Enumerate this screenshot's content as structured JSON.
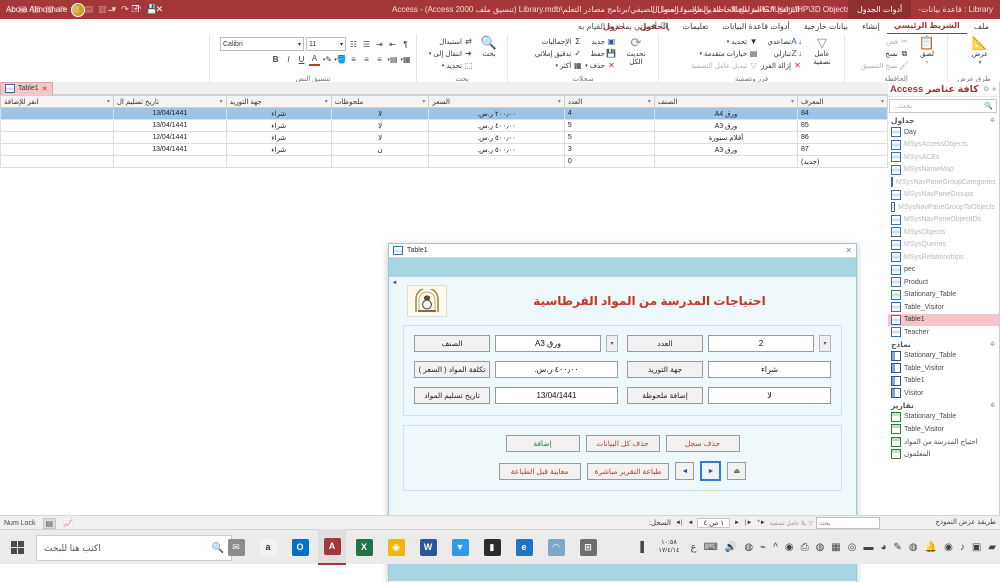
{
  "titlebar": {
    "doc_title": "البرامج الخاصة بالطلاب الذين درسوا الفصل الصيفي/برنامج مصادر التعلم\\Library.mdb (تنسيق ملف Access 2000)  -  Access",
    "doc_path": "C:\\Users\\HP\\3D Objects\\البرامج الخاصة بالطلاب درسوا ال",
    "db_name": "Library : قاعدة بيانات-",
    "context_tab": "أدوات الجدول",
    "account_name": "Abo-a Almoshare",
    "qat": [
      "save-icon",
      "undo-icon",
      "redo-icon",
      "customize-icon"
    ],
    "window_buttons": [
      "minimize",
      "restore",
      "close"
    ]
  },
  "ribbon": {
    "tabs": [
      {
        "label": "ملف",
        "state": "normal"
      },
      {
        "label": "الشريط الرئيسي",
        "state": "active"
      },
      {
        "label": "إنشاء",
        "state": "normal"
      },
      {
        "label": "بيانات خارجية",
        "state": "normal"
      },
      {
        "label": "أدوات قاعدة البيانات",
        "state": "normal"
      },
      {
        "label": "تعليمات",
        "state": "normal"
      },
      {
        "label": "الحقول",
        "state": "context"
      },
      {
        "label": "جدول",
        "state": "context"
      }
    ],
    "tellme": "أخبرني بما تريد القيام به",
    "groups": [
      {
        "name": "طرق عرض",
        "label": "طرق عرض",
        "big": {
          "label": "عرض",
          "icon": "view-icon"
        },
        "items": []
      },
      {
        "name": "الحافظة",
        "label": "الحافظة",
        "big": {
          "label": "لصق",
          "icon": "paste-icon"
        },
        "items": [
          {
            "label": "قص",
            "icon": "cut-icon",
            "dim": true
          },
          {
            "label": "نسخ",
            "icon": "copy-icon",
            "dim": false
          },
          {
            "label": "نسخ التنسيق",
            "icon": "format-painter-icon",
            "dim": true
          }
        ]
      },
      {
        "name": "فرز وتصفية",
        "label": "فرز وتصفية",
        "big": {
          "label": "عامل تصفية",
          "icon": "filter-icon"
        },
        "items": [
          {
            "label": "تصاعدي",
            "icon": "sort-asc-icon",
            "dim": false
          },
          {
            "label": "تنازلي",
            "icon": "sort-desc-icon",
            "dim": false
          },
          {
            "label": "إزالة الفرز",
            "icon": "clear-sort-icon",
            "dim": false
          },
          {
            "label": "تحديد",
            "icon": "selection-icon",
            "dim": false
          },
          {
            "label": "خيارات متقدمة",
            "icon": "advanced-icon",
            "dim": false
          },
          {
            "label": "تبديل عامل التصفية",
            "icon": "toggle-filter-icon",
            "dim": true
          }
        ]
      },
      {
        "name": "سجلات",
        "label": "سجلات",
        "big": {
          "label": "تحديث الكل",
          "icon": "refresh-all-icon"
        },
        "items": [
          {
            "label": "جديد",
            "icon": "new-record-icon",
            "dim": false
          },
          {
            "label": "حفظ",
            "icon": "save-record-icon",
            "dim": false
          },
          {
            "label": "حذف",
            "icon": "delete-record-icon",
            "dim": false
          },
          {
            "label": "الإجماليات",
            "icon": "totals-icon",
            "dim": false
          },
          {
            "label": "تدقيق إملائي",
            "icon": "spelling-icon",
            "dim": false
          },
          {
            "label": "أكثر",
            "icon": "more-icon",
            "dim": false
          }
        ]
      },
      {
        "name": "بحث",
        "label": "بحث",
        "big": {
          "label": "بحث",
          "icon": "search-icon"
        },
        "items": [
          {
            "label": "استبدال",
            "icon": "replace-icon",
            "dim": false
          },
          {
            "label": "انتقال إلى",
            "icon": "goto-icon",
            "dim": false
          },
          {
            "label": "تحديد",
            "icon": "select-icon",
            "dim": false
          }
        ]
      },
      {
        "name": "تنسيق النص",
        "label": "تنسيق النص",
        "font_name": "Calibri",
        "font_size": "11",
        "items": [
          {
            "label": "B",
            "icon": "bold-icon"
          },
          {
            "label": "I",
            "icon": "italic-icon"
          },
          {
            "label": "U",
            "icon": "underline-icon"
          },
          {
            "label": "A",
            "icon": "font-color-icon"
          },
          {
            "label": "✎",
            "icon": "highlight-icon"
          },
          {
            "label": "▨",
            "icon": "fill-color-icon"
          },
          {
            "label": "≡",
            "icon": "align-right-icon"
          },
          {
            "label": "≡",
            "icon": "align-center-icon"
          },
          {
            "label": "≡",
            "icon": "align-left-icon"
          },
          {
            "label": "▦",
            "icon": "gridlines-icon"
          },
          {
            "label": "▤",
            "icon": "alternate-row-icon"
          },
          {
            "label": "⇥",
            "icon": "increase-indent-icon"
          },
          {
            "label": "⇤",
            "icon": "decrease-indent-icon"
          },
          {
            "label": "¶",
            "icon": "rtl-direction-icon"
          }
        ]
      }
    ]
  },
  "navpane": {
    "title": "كافة عناصر Access",
    "collapse_icon": "«",
    "dropdown_icon": "⊙",
    "search_placeholder": "بحث...",
    "search_icon": "search-icon",
    "groups": [
      {
        "title": "جداول",
        "items": [
          {
            "label": "Day",
            "type": "table",
            "selected": false
          },
          {
            "label": "MSysAccessObjects",
            "type": "table",
            "selected": false,
            "system": true
          },
          {
            "label": "MSysACEs",
            "type": "table",
            "selected": false,
            "system": true
          },
          {
            "label": "MSysNameMap",
            "type": "table",
            "selected": false,
            "system": true
          },
          {
            "label": "MSysNavPaneGroupCategories",
            "type": "table",
            "selected": false,
            "system": true
          },
          {
            "label": "MSysNavPaneGroups",
            "type": "table",
            "selected": false,
            "system": true
          },
          {
            "label": "MSysNavPaneGroupToObjects",
            "type": "table",
            "selected": false,
            "system": true
          },
          {
            "label": "MSysNavPaneObjectIDs",
            "type": "table",
            "selected": false,
            "system": true
          },
          {
            "label": "MSysObjects",
            "type": "table",
            "selected": false,
            "system": true
          },
          {
            "label": "MSysQueries",
            "type": "table",
            "selected": false,
            "system": true
          },
          {
            "label": "MSysRelationships",
            "type": "table",
            "selected": false,
            "system": true
          },
          {
            "label": "pec",
            "type": "table",
            "selected": false
          },
          {
            "label": "Product",
            "type": "table",
            "selected": false
          },
          {
            "label": "Stationary_Table",
            "type": "table",
            "selected": false
          },
          {
            "label": "Table_Visitor",
            "type": "table",
            "selected": false
          },
          {
            "label": "Table1",
            "type": "table",
            "selected": true
          },
          {
            "label": "Teacher",
            "type": "table",
            "selected": false
          }
        ]
      },
      {
        "title": "نماذج",
        "items": [
          {
            "label": "Stationary_Table",
            "type": "form",
            "selected": false
          },
          {
            "label": "Table_Visitor",
            "type": "form",
            "selected": false
          },
          {
            "label": "Table1",
            "type": "form",
            "selected": false
          },
          {
            "label": "Visitor",
            "type": "form",
            "selected": false
          }
        ]
      },
      {
        "title": "تقارير",
        "items": [
          {
            "label": "Stationary_Table",
            "type": "report",
            "selected": false
          },
          {
            "label": "Table_Visitor",
            "type": "report",
            "selected": false
          },
          {
            "label": "احتياج المدرسة من المواد",
            "type": "report",
            "selected": false
          },
          {
            "label": "المعلمون",
            "type": "report",
            "selected": false
          }
        ]
      }
    ]
  },
  "datasheet": {
    "tab_label": "Table1",
    "tab_close": "✕",
    "columns": [
      {
        "label": "المعرف"
      },
      {
        "label": "الصنف"
      },
      {
        "label": "العدد"
      },
      {
        "label": "السعر"
      },
      {
        "label": "ملحوظات"
      },
      {
        "label": "جهة التوريد"
      },
      {
        "label": "تاريخ تسليم ال"
      },
      {
        "label": "انقر للإضافة"
      }
    ],
    "rows": [
      {
        "selected": true,
        "id": "84",
        "item": "ورق A4",
        "count": "4",
        "price": "٢٠٠٫٠٠ ر.س.",
        "notes": "لا",
        "supplier": "شراء",
        "date": "13/04/1441",
        "add": ""
      },
      {
        "selected": false,
        "id": "85",
        "item": "ورق A3",
        "count": "5",
        "price": "٤٠٠٫٠٠ ر.س.",
        "notes": "لا",
        "supplier": "شراء",
        "date": "13/04/1441",
        "add": ""
      },
      {
        "selected": false,
        "id": "86",
        "item": "أقلام سبورة",
        "count": "5",
        "price": "٥٠٠٫٠٠ ر.س.",
        "notes": "لا",
        "supplier": "شراء",
        "date": "12/04/1441",
        "add": ""
      },
      {
        "selected": false,
        "id": "87",
        "item": "ورق A3",
        "count": "3",
        "price": "٥٠٠٫٠٠ ر.س.",
        "notes": "ن",
        "supplier": "شراء",
        "date": "13/04/1441",
        "add": ""
      },
      {
        "selected": false,
        "id": "(جديد)",
        "item": "",
        "count": "0",
        "price": "",
        "notes": "",
        "supplier": "",
        "date": "",
        "add": "",
        "is_new": true
      }
    ]
  },
  "modal": {
    "title": "Table1",
    "close_icon": "✕",
    "heading": "احتياجات المدرسة من المواد القرطاسية",
    "logo_alt": "school-emblem",
    "fields": [
      {
        "label": "الصنف",
        "value": "ورق A3",
        "has_dropdown": true,
        "ltr": false,
        "name": "item"
      },
      {
        "label": "العدد",
        "value": "2",
        "has_dropdown": true,
        "ltr": true,
        "name": "count"
      },
      {
        "label": "تكلفة المواد ( السعر )",
        "value": "٤٠٠٫٠٠ ر.س.",
        "has_dropdown": false,
        "ltr": false,
        "name": "price"
      },
      {
        "label": "جهة التوريد",
        "value": "شراء",
        "has_dropdown": false,
        "ltr": false,
        "name": "supplier"
      },
      {
        "label": "تاريخ تسليم المواد",
        "value": "13/04/1441",
        "has_dropdown": false,
        "ltr": true,
        "name": "delivery-date"
      },
      {
        "label": "إضافة ملحوظة",
        "value": "لا",
        "has_dropdown": false,
        "ltr": false,
        "name": "note"
      }
    ],
    "action_buttons": [
      {
        "label": "إضافة",
        "color": "#2e7d32",
        "name": "add-record-button"
      },
      {
        "label": "حذف كل البيانات",
        "color": "#c0392b",
        "name": "delete-all-button"
      },
      {
        "label": "حذف سجل",
        "color": "#c0392b",
        "name": "delete-record-button"
      }
    ],
    "nav_buttons": [
      {
        "label": "معاينة قبل الطباعة",
        "color": "#c0392b",
        "name": "print-preview-button",
        "kind": "wide"
      },
      {
        "label": "طباعة التقرير مباشرة",
        "color": "#c0392b",
        "name": "print-direct-button",
        "kind": "wide"
      },
      {
        "label": "◄",
        "color": "#2f5597",
        "name": "previous-record-button",
        "kind": "nav"
      },
      {
        "label": "►",
        "color": "#2f5597",
        "name": "next-record-button",
        "kind": "nav",
        "focused": true
      },
      {
        "label": "⏏",
        "color": "#4b7a3a",
        "name": "exit-button",
        "kind": "nav"
      }
    ],
    "scroll_arrow": "◄"
  },
  "statusbar": {
    "view_label": "طريقة عرض النموذج",
    "record_label": "السجل:",
    "record_position": "١ من ٤",
    "nav_first": "|◄",
    "nav_prev": "◄",
    "nav_next": "►",
    "nav_last": "►|",
    "nav_new": "►*",
    "filter_label": "بلا عامل تصفية",
    "search_placeholder": "بحث",
    "num_lock": "Num Lock",
    "view_icons": [
      "form-view-icon",
      "datasheet-view-icon"
    ]
  },
  "taskbar": {
    "search_placeholder": "اكتب هنا للبحث",
    "search_icon": "search-icon",
    "start_icon": "windows-start-icon",
    "apps": [
      {
        "name": "task-view-icon",
        "glyph": "⊞",
        "bg": "#6d6d6d",
        "active": false
      },
      {
        "name": "cortana-icon",
        "glyph": "◠",
        "bg": "#7da7c4",
        "active": false
      },
      {
        "name": "edge-icon",
        "glyph": "e",
        "bg": "#1a76c8",
        "active": false
      },
      {
        "name": "store-icon",
        "glyph": "▮",
        "bg": "#2b2b2b",
        "active": false
      },
      {
        "name": "dropbox-icon",
        "glyph": "▼",
        "bg": "#2e9ae8",
        "active": false
      },
      {
        "name": "word-icon",
        "glyph": "W",
        "bg": "#2b579a",
        "active": false
      },
      {
        "name": "chrome-icon",
        "glyph": "◉",
        "bg": "#f4b400",
        "active": false
      },
      {
        "name": "excel-icon",
        "glyph": "X",
        "bg": "#217346",
        "active": false
      },
      {
        "name": "access-icon",
        "glyph": "A",
        "bg": "#a4373a",
        "active": true
      },
      {
        "name": "outlook-icon",
        "glyph": "O",
        "bg": "#0072c6",
        "active": false
      },
      {
        "name": "notepad-icon",
        "glyph": "a",
        "bg": "#f2f2f2",
        "active": false
      },
      {
        "name": "mail-icon",
        "glyph": "✉",
        "bg": "#8b8b8b",
        "active": false
      }
    ],
    "tray": [
      {
        "name": "show-desktop-icon",
        "glyph": "▌"
      },
      {
        "name": "clock",
        "time": "١٠:٥٨",
        "date": "١٧/٤/١٤"
      },
      {
        "name": "language-icon",
        "glyph": "ع"
      },
      {
        "name": "keyboard-icon",
        "glyph": "⌨"
      },
      {
        "name": "volume-icon",
        "glyph": "🔊"
      },
      {
        "name": "battery-icon",
        "glyph": "◍"
      },
      {
        "name": "network-icon",
        "glyph": "⌁"
      },
      {
        "name": "chevron-up-icon",
        "glyph": "^"
      },
      {
        "name": "antivirus-icon",
        "glyph": "◉"
      },
      {
        "name": "printer-icon",
        "glyph": "⎙"
      },
      {
        "name": "globe-icon",
        "glyph": "◍"
      },
      {
        "name": "spreadsheet-icon",
        "glyph": "▦"
      },
      {
        "name": "shield-icon",
        "glyph": "◎"
      },
      {
        "name": "book-icon",
        "glyph": "▬"
      },
      {
        "name": "internet-icon",
        "glyph": "◕"
      },
      {
        "name": "tool-icon",
        "glyph": "✎"
      },
      {
        "name": "whatsapp-icon",
        "glyph": "◍"
      },
      {
        "name": "notification-bell-icon",
        "glyph": "🔔"
      },
      {
        "name": "firefox-icon",
        "glyph": "◉"
      },
      {
        "name": "sound-icon",
        "glyph": "♪"
      },
      {
        "name": "window-icon",
        "glyph": "▣"
      },
      {
        "name": "folder-icon",
        "glyph": "▰"
      }
    ]
  }
}
